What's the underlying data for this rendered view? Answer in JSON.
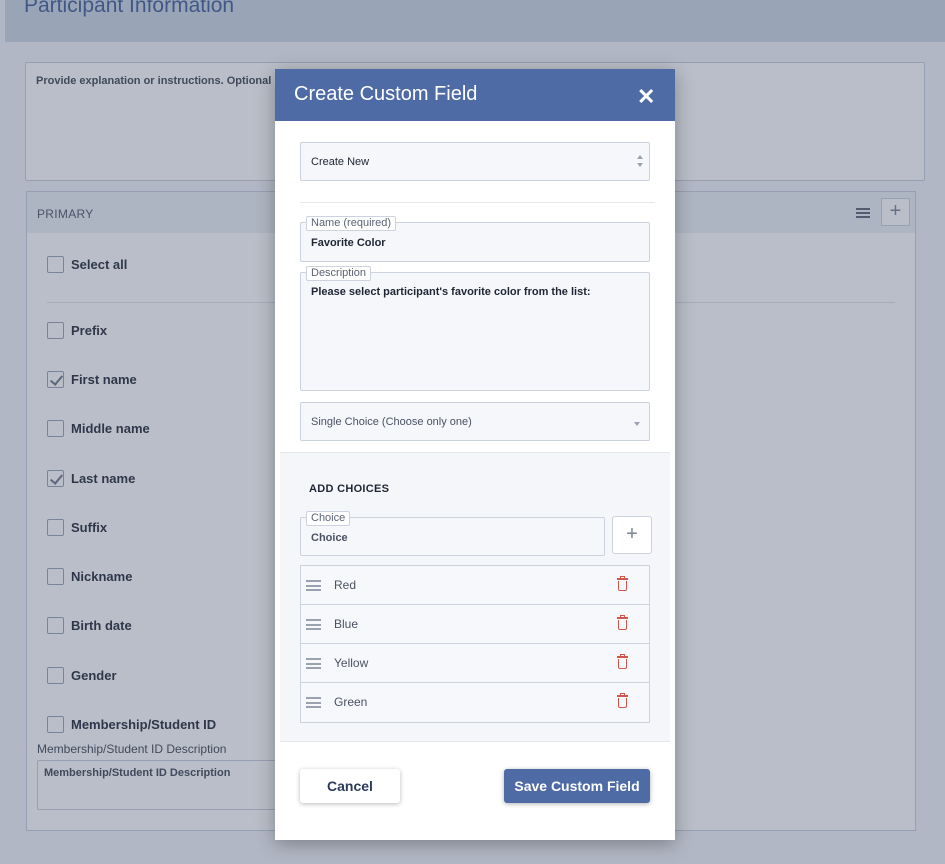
{
  "page": {
    "title": "Participant Information",
    "instructions_placeholder": "Provide explanation or instructions. Optional",
    "primary_label": "PRIMARY",
    "add_icon": "plus-icon",
    "menu_icon": "menu-icon",
    "select_all": "Select all",
    "fields": [
      {
        "label": "Prefix",
        "checked": false
      },
      {
        "label": "First name",
        "checked": true
      },
      {
        "label": "Middle name",
        "checked": false
      },
      {
        "label": "Last name",
        "checked": true
      },
      {
        "label": "Suffix",
        "checked": false
      },
      {
        "label": "Nickname",
        "checked": false
      },
      {
        "label": "Birth date",
        "checked": false
      },
      {
        "label": "Gender",
        "checked": false
      },
      {
        "label": "Membership/Student ID",
        "checked": false
      }
    ],
    "msid_desc_label": "Membership/Student ID Description",
    "msid_desc_placeholder": "Membership/Student ID Description"
  },
  "modal": {
    "title": "Create Custom Field",
    "close_icon": "close-icon",
    "mode_select": "Create New",
    "name_label": "Name (required)",
    "name_value": "Favorite Color",
    "description_label": "Description",
    "description_value": "Please select participant's favorite color from the list:",
    "type_select": "Single Choice (Choose only one)",
    "add_choices_title": "ADD CHOICES",
    "choice_label": "Choice",
    "choice_placeholder": "Choice",
    "add_choice_icon": "plus-icon",
    "choices": [
      {
        "label": "Red"
      },
      {
        "label": "Blue"
      },
      {
        "label": "Yellow"
      },
      {
        "label": "Green"
      }
    ],
    "cancel_label": "Cancel",
    "save_label": "Save Custom Field"
  },
  "colors": {
    "accent": "#4e6ba5",
    "delete": "#d4544a"
  }
}
